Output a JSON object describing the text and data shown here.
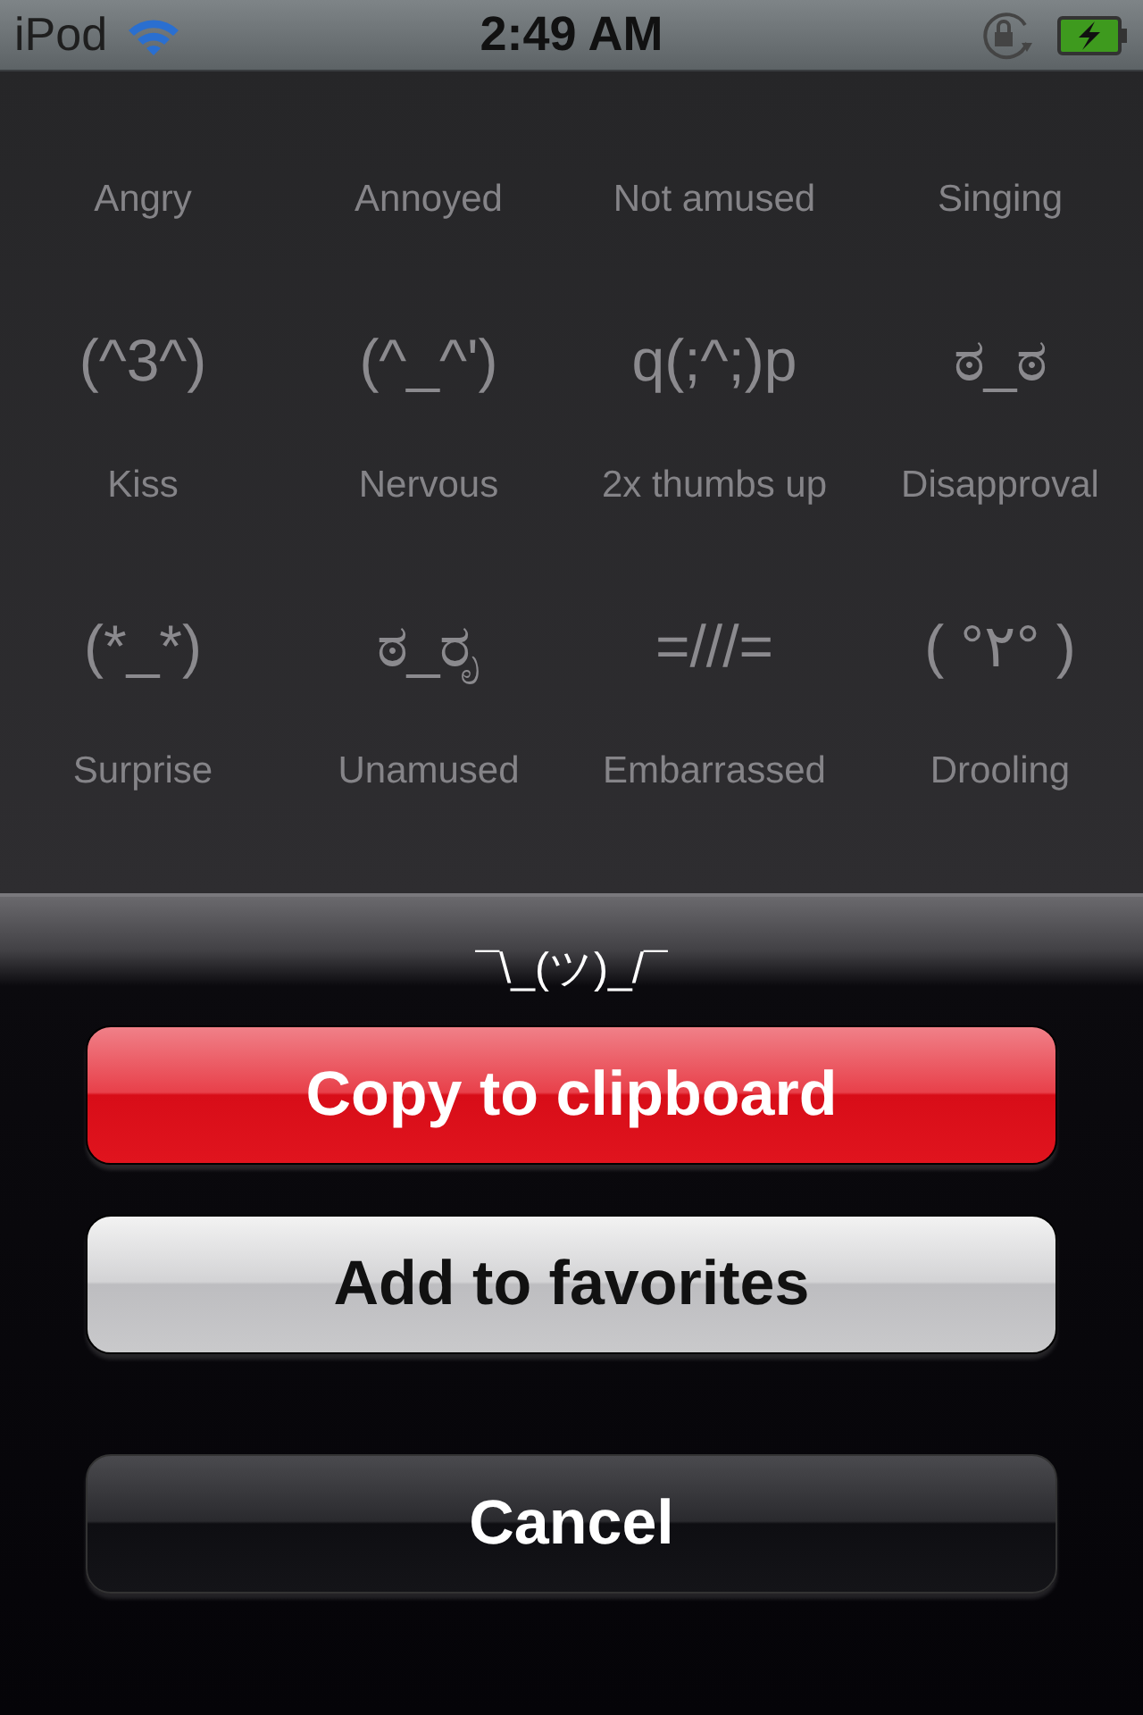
{
  "status_bar": {
    "carrier": "iPod",
    "time": "2:49 AM"
  },
  "emoticons": [
    {
      "label": "Angry"
    },
    {
      "label": "Annoyed"
    },
    {
      "label": "Not amused"
    },
    {
      "label": "Singing"
    },
    {
      "face": "(^3^)",
      "label": "Kiss"
    },
    {
      "face": "(^_^')",
      "label": "Nervous"
    },
    {
      "face": "q(;^;)p",
      "label": "2x thumbs up"
    },
    {
      "face": "ಠ_ಠ",
      "label": "Disapproval"
    },
    {
      "face": "(*_*)",
      "label": "Surprise"
    },
    {
      "face": "ಠ_ರೃ",
      "label": "Unamused"
    },
    {
      "face": "=///=",
      "label": "Embarrassed"
    },
    {
      "face": "( °٢° )",
      "label": "Drooling"
    }
  ],
  "action_sheet": {
    "title": "¯\\_(ツ)_/¯",
    "buttons": [
      {
        "label": "Copy to clipboard",
        "kind": "destructive"
      },
      {
        "label": "Add to favorites",
        "kind": "default"
      },
      {
        "label": "Cancel",
        "kind": "cancel"
      }
    ]
  }
}
